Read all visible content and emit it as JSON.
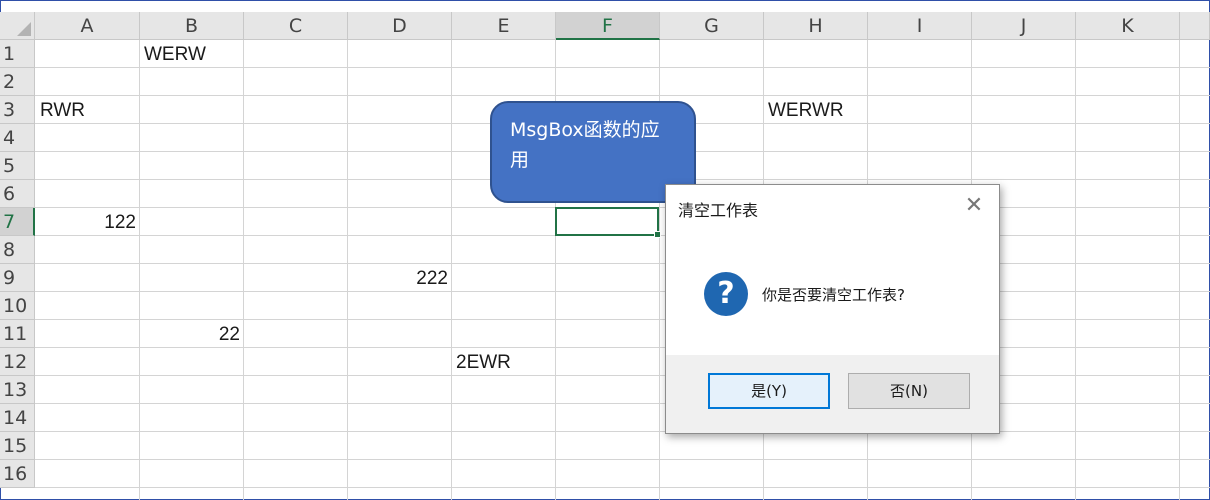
{
  "columns": [
    "A",
    "B",
    "C",
    "D",
    "E",
    "F",
    "G",
    "H",
    "I",
    "J",
    "K"
  ],
  "rows": [
    "1",
    "2",
    "3",
    "4",
    "5",
    "6",
    "7",
    "8",
    "9",
    "10",
    "11",
    "12",
    "13",
    "14",
    "15",
    "16"
  ],
  "selected_column": "F",
  "selected_row": "7",
  "cells": {
    "b1": "WERW",
    "a3": "RWR",
    "h3": "WERWR",
    "a7": "122",
    "d9": "222",
    "b11": "22",
    "e12": "2EWR"
  },
  "shape": {
    "text": "MsgBox函数的应用",
    "fill_color": "#4472c4"
  },
  "dialog": {
    "title": "清空工作表",
    "close_glyph": "✕",
    "icon": "question-icon",
    "icon_glyph": "?",
    "message": "你是否要清空工作表?",
    "yes_label": "是(Y)",
    "no_label": "否(N)"
  },
  "accent_color": "#217346"
}
